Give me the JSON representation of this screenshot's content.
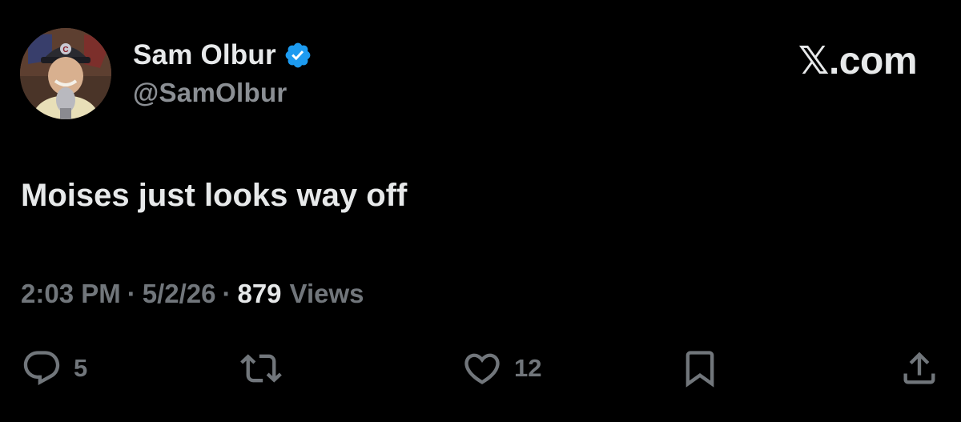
{
  "author": {
    "display_name": "Sam Olbur",
    "handle": "@SamOlbur",
    "verified_color": "#1d9bf0"
  },
  "brand": "𝕏.com",
  "tweet": {
    "text": "Moises just looks way off",
    "time": "2:03 PM",
    "date": "5/2/26",
    "separator": "·",
    "views_count": "879",
    "views_label": "Views"
  },
  "actions": {
    "replies": "5",
    "reposts": "",
    "likes": "12"
  },
  "icons": [
    "reply-icon",
    "repost-icon",
    "like-icon",
    "bookmark-icon",
    "share-icon",
    "verified-badge-icon"
  ]
}
